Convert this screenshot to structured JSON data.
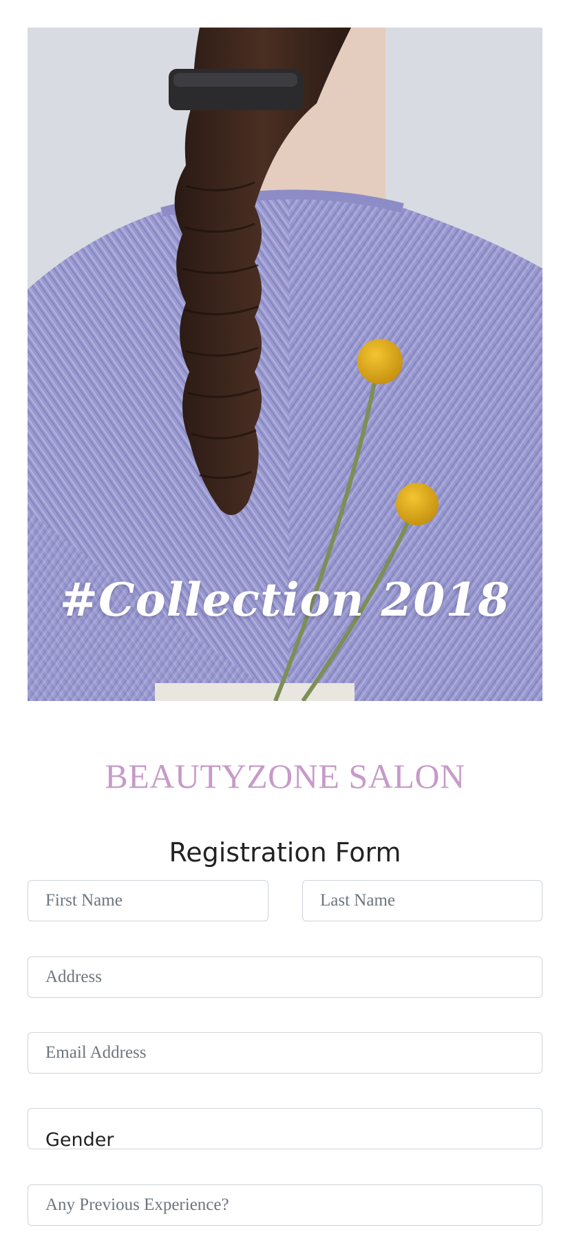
{
  "hero": {
    "caption": "#Collection 2018"
  },
  "brand": {
    "name": "BEAUTYZONE SALON",
    "color": "#c79ac9"
  },
  "form": {
    "title": "Registration Form",
    "first_name_placeholder": "First Name",
    "last_name_placeholder": "Last Name",
    "address_placeholder": "Address",
    "email_placeholder": "Email Address",
    "gender_label": "Gender",
    "experience_placeholder": "Any Previous Experience?"
  }
}
